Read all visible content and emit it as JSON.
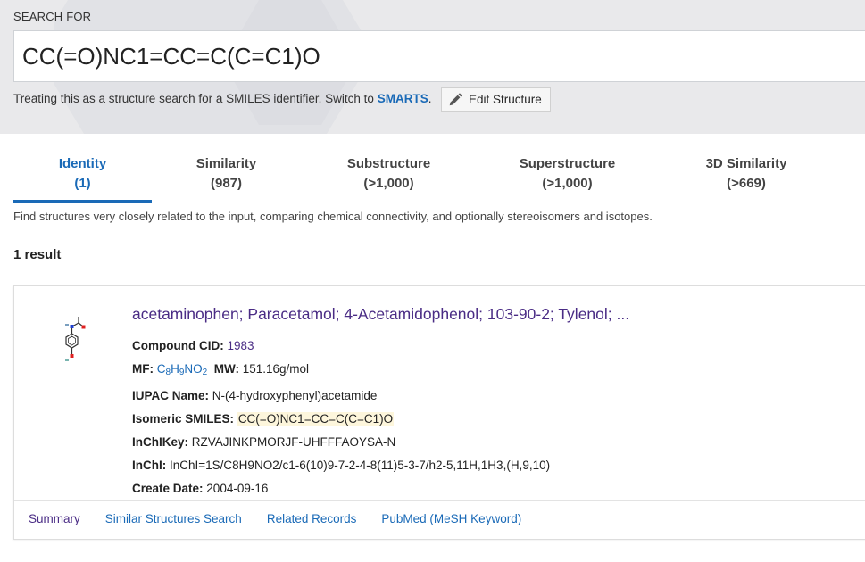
{
  "search": {
    "label": "SEARCH FOR",
    "value": "CC(=O)NC1=CC=C(C=C1)O",
    "hint_prefix": "Treating this as a structure search for a SMILES identifier. Switch to",
    "hint_link": "SMARTS",
    "hint_suffix": ".",
    "edit_button": "Edit Structure",
    "edit_icon": "pencil-icon"
  },
  "tabs": [
    {
      "label": "Identity",
      "count": "(1)",
      "active": true
    },
    {
      "label": "Similarity",
      "count": "(987)",
      "active": false
    },
    {
      "label": "Substructure",
      "count": "(>1,000)",
      "active": false
    },
    {
      "label": "Superstructure",
      "count": "(>1,000)",
      "active": false
    },
    {
      "label": "3D Similarity",
      "count": "(>669)",
      "active": false
    }
  ],
  "description": "Find structures very closely related to the input, comparing chemical connectivity, and optionally stereoisomers and isotopes.",
  "result_count": "1 result",
  "result": {
    "title": "acetaminophen; Paracetamol; 4-Acetamidophenol; 103-90-2; Tylenol; ...",
    "cid_label": "Compound CID:",
    "cid": "1983",
    "mf_label": "MF:",
    "mf_parts": [
      "C",
      "8",
      "H",
      "9",
      "NO",
      "2"
    ],
    "mw_label": "MW:",
    "mw": "151.16g/mol",
    "iupac_label": "IUPAC Name:",
    "iupac": "N-(4-hydroxyphenyl)acetamide",
    "smiles_label": "Isomeric SMILES:",
    "smiles": "CC(=O)NC1=CC=C(C=C1)O",
    "inchikey_label": "InChIKey:",
    "inchikey": "RZVAJINKPMORJF-UHFFFAOYSA-N",
    "inchi_label": "InChI:",
    "inchi": "InChI=1S/C8H9NO2/c1-6(10)9-7-2-4-8(11)5-3-7/h2-5,11H,1H3,(H,9,10)",
    "date_label": "Create Date:",
    "date": "2004-09-16",
    "links": [
      "Summary",
      "Similar Structures Search",
      "Related Records",
      "PubMed (MeSH Keyword)"
    ]
  },
  "colors": {
    "accent": "#1a6ab7",
    "visited": "#4a2c85",
    "header_bg": "#e9e9eb",
    "highlight": "#fdf6dc"
  }
}
